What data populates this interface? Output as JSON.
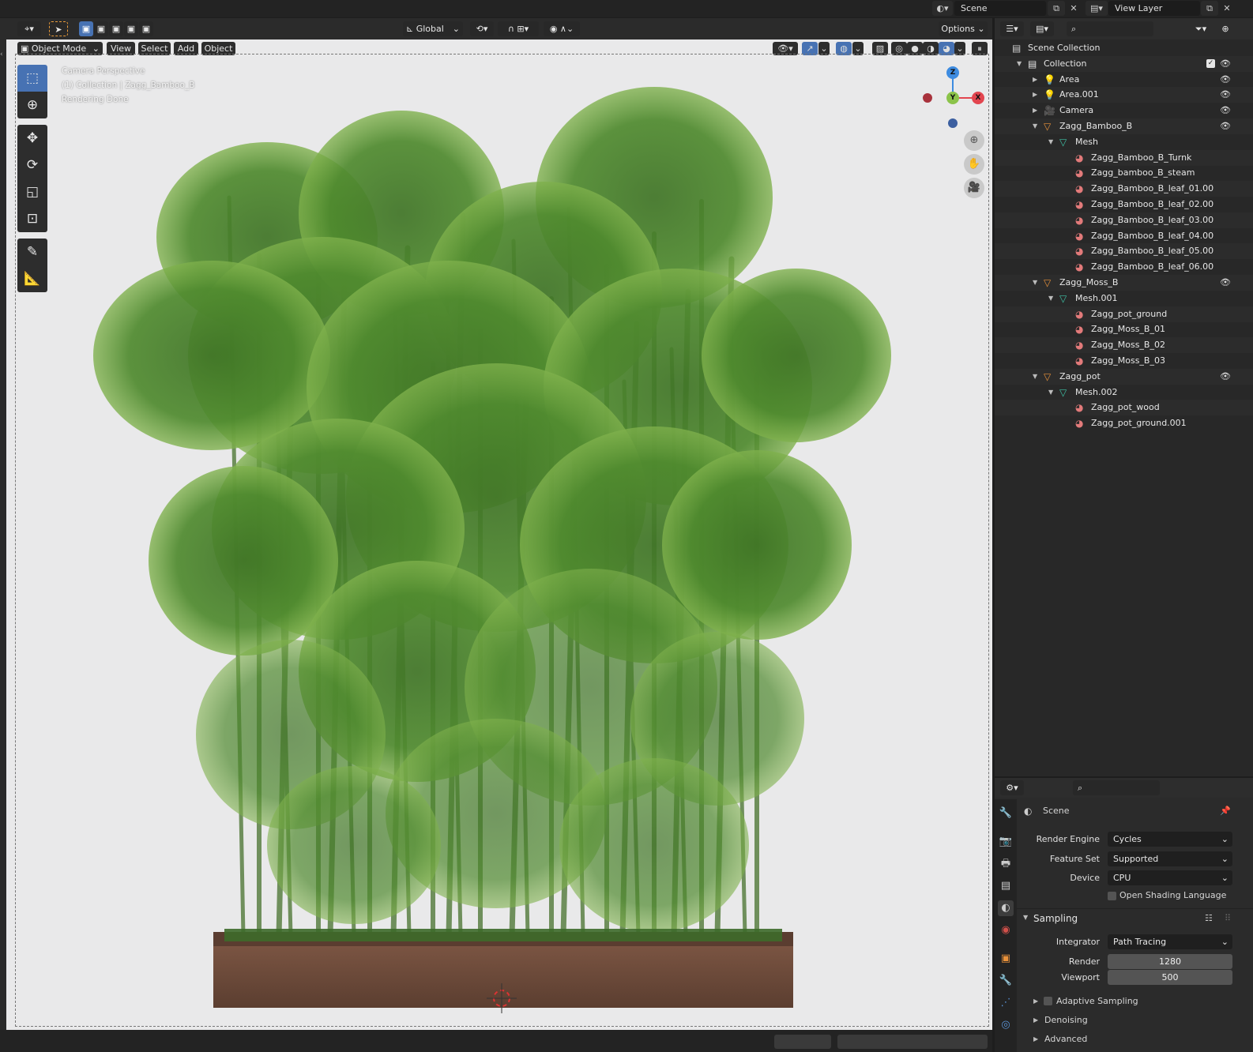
{
  "topbar": {
    "scene_label": "Scene",
    "view_layer_label": "View Layer"
  },
  "header": {
    "orientation": "Global",
    "options": "Options"
  },
  "viewport_menu": {
    "mode": "Object Mode",
    "view": "View",
    "select": "Select",
    "add": "Add",
    "object": "Object"
  },
  "overlay": {
    "line1": "Camera Perspective",
    "line2": "(1) Collection | Zagg_Bamboo_B",
    "line3": "Rendering Done"
  },
  "gizmo": {
    "z": "Z",
    "y": "Y",
    "x": "X",
    "colors": {
      "x": "#e2454f",
      "y": "#8bc34a",
      "z": "#3d8be0",
      "neg_x": "#a8323c",
      "neg_z": "#3c5fa0"
    }
  },
  "toolbar_icons": [
    "select-box-icon",
    "cursor-icon",
    "move-icon",
    "rotate-icon",
    "scale-icon",
    "transform-icon",
    "annotate-icon",
    "measure-icon"
  ],
  "outliner": {
    "rows": [
      {
        "label": "Scene Collection",
        "depth": 0,
        "icon": "scene-collection-icon",
        "tri": ""
      },
      {
        "label": "Collection",
        "depth": 1,
        "icon": "collection-icon",
        "tri": "▼"
      },
      {
        "label": "Area",
        "depth": 2,
        "icon": "light-icon",
        "tri": "▶"
      },
      {
        "label": "Area.001",
        "depth": 2,
        "icon": "light-icon",
        "tri": "▶"
      },
      {
        "label": "Camera",
        "depth": 2,
        "icon": "camera-icon",
        "tri": "▶"
      },
      {
        "label": "Zagg_Bamboo_B",
        "depth": 2,
        "icon": "mesh-object-icon",
        "tri": "▼"
      },
      {
        "label": "Mesh",
        "depth": 3,
        "icon": "mesh-data-icon",
        "tri": "▼"
      },
      {
        "label": "Zagg_Bamboo_B_Turnk",
        "depth": 4,
        "icon": "material-icon",
        "tri": ""
      },
      {
        "label": "Zagg_bamboo_B_steam",
        "depth": 4,
        "icon": "material-icon",
        "tri": ""
      },
      {
        "label": "Zagg_Bamboo_B_leaf_01.00",
        "depth": 4,
        "icon": "material-icon",
        "tri": ""
      },
      {
        "label": "Zagg_Bamboo_B_leaf_02.00",
        "depth": 4,
        "icon": "material-icon",
        "tri": ""
      },
      {
        "label": "Zagg_Bamboo_B_leaf_03.00",
        "depth": 4,
        "icon": "material-icon",
        "tri": ""
      },
      {
        "label": "Zagg_Bamboo_B_leaf_04.00",
        "depth": 4,
        "icon": "material-icon",
        "tri": ""
      },
      {
        "label": "Zagg_Bamboo_B_leaf_05.00",
        "depth": 4,
        "icon": "material-icon",
        "tri": ""
      },
      {
        "label": "Zagg_Bamboo_B_leaf_06.00",
        "depth": 4,
        "icon": "material-icon",
        "tri": ""
      },
      {
        "label": "Zagg_Moss_B",
        "depth": 2,
        "icon": "mesh-object-icon",
        "tri": "▼"
      },
      {
        "label": "Mesh.001",
        "depth": 3,
        "icon": "mesh-data-icon",
        "tri": "▼"
      },
      {
        "label": "Zagg_pot_ground",
        "depth": 4,
        "icon": "material-icon",
        "tri": ""
      },
      {
        "label": "Zagg_Moss_B_01",
        "depth": 4,
        "icon": "material-icon",
        "tri": ""
      },
      {
        "label": "Zagg_Moss_B_02",
        "depth": 4,
        "icon": "material-icon",
        "tri": ""
      },
      {
        "label": "Zagg_Moss_B_03",
        "depth": 4,
        "icon": "material-icon",
        "tri": ""
      },
      {
        "label": "Zagg_pot",
        "depth": 2,
        "icon": "mesh-object-icon",
        "tri": "▼"
      },
      {
        "label": "Mesh.002",
        "depth": 3,
        "icon": "mesh-data-icon",
        "tri": "▼"
      },
      {
        "label": "Zagg_pot_wood",
        "depth": 4,
        "icon": "material-icon",
        "tri": ""
      },
      {
        "label": "Zagg_pot_ground.001",
        "depth": 4,
        "icon": "material-icon",
        "tri": ""
      }
    ]
  },
  "properties": {
    "context": "Scene",
    "render_engine_label": "Render Engine",
    "render_engine_value": "Cycles",
    "feature_set_label": "Feature Set",
    "feature_set_value": "Supported",
    "device_label": "Device",
    "device_value": "CPU",
    "osl_label": "Open Shading Language",
    "sampling_label": "Sampling",
    "integrator_label": "Integrator",
    "integrator_value": "Path Tracing",
    "render_label": "Render",
    "render_value": "1280",
    "viewport_label": "Viewport",
    "viewport_value": "500",
    "adaptive_label": "Adaptive Sampling",
    "denoising_label": "Denoising",
    "advanced_label": "Advanced"
  },
  "colors": {
    "accent": "#4772b3",
    "leaf_dark": "#2f5a1f",
    "leaf_mid": "#4f8a2e",
    "leaf_light": "#7fb14c",
    "stem": "#6f8f5c",
    "pot": "#6b4a38"
  }
}
